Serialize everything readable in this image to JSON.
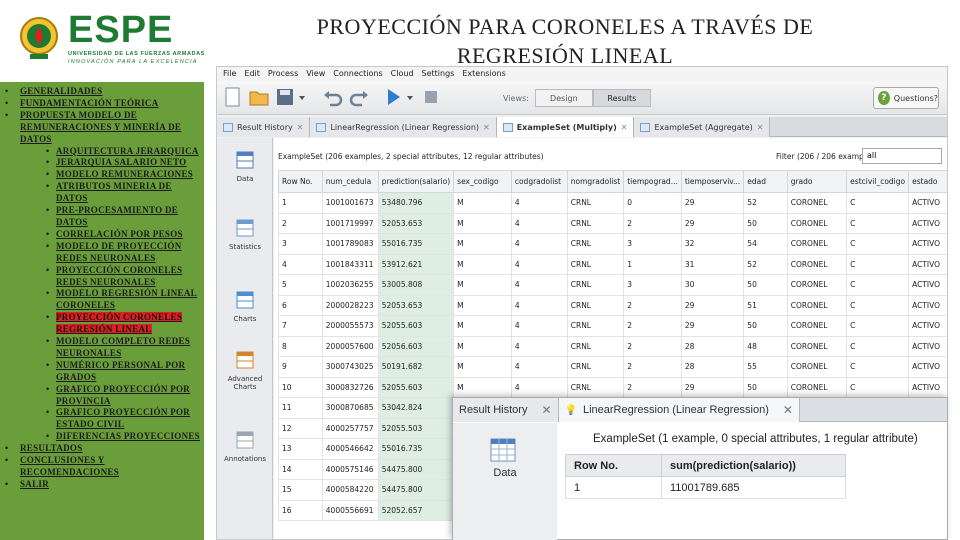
{
  "brand": {
    "name": "ESPE",
    "subtitle1": "UNIVERSIDAD DE LAS FUERZAS ARMADAS",
    "subtitle2": "INNOVACIÓN PARA LA EXCELENCIA",
    "color": "#1e7b34"
  },
  "slide": {
    "title": "PROYECCIÓN PARA CORONELES A TRAVÉS DE REGRESIÓN LINEAL"
  },
  "outline": {
    "panel_color": "#6a9e3a",
    "highlight_color": "#e02020",
    "items": [
      {
        "level": 1,
        "text": "GENERALIDADES"
      },
      {
        "level": 1,
        "text": "FUNDAMENTACIÓN TEÓRICA"
      },
      {
        "level": 1,
        "text": "PROPUESTA MODELO DE REMUNERACIONES Y MINERÍA DE DATOS"
      },
      {
        "level": 2,
        "text": "ARQUITECTURA JERARQUICA"
      },
      {
        "level": 2,
        "text": "JERARQUIA SALARIO NETO"
      },
      {
        "level": 2,
        "text": "MODELO REMUNERACIONES"
      },
      {
        "level": 2,
        "text": "ATRIBUTOS MINERIA DE DATOS"
      },
      {
        "level": 2,
        "text": "PRE-PROCESAMIENTO DE DATOS"
      },
      {
        "level": 2,
        "text": "CORRELACIÓN POR PESOS"
      },
      {
        "level": 2,
        "text": "MODELO DE PROYECCIÓN REDES NEURONALES"
      },
      {
        "level": 2,
        "text": "PROYECCIÓN CORONELES REDES NEURONALES"
      },
      {
        "level": 2,
        "text": "MODELO REGRESIÓN LINEAL CORONELES"
      },
      {
        "level": 2,
        "text": "PROYECCIÓN CORONELES REGRESIÓN LINEAL",
        "highlighted": true
      },
      {
        "level": 2,
        "text": "MODELO COMPLETO REDES NEURONALES"
      },
      {
        "level": 2,
        "text": "NUMÉRICO PERSONAL POR GRADOS"
      },
      {
        "level": 2,
        "text": "GRAFICO PROYECCIÓN POR PROVINCIA"
      },
      {
        "level": 2,
        "text": "GRAFICO PROYECCIÓN POR ESTADO CIVIL"
      },
      {
        "level": 2,
        "text": "DIFERENCIAS PROYECCIONES"
      },
      {
        "level": 1,
        "text": "RESULTADOS"
      },
      {
        "level": 1,
        "text": "CONCLUSIONES Y RECOMENDACIONES"
      },
      {
        "level": 1,
        "text": "SALIR"
      }
    ]
  },
  "app": {
    "menu": [
      "File",
      "Edit",
      "Process",
      "View",
      "Connections",
      "Cloud",
      "Settings",
      "Extensions"
    ],
    "views": {
      "label": "Views:",
      "design": "Design",
      "results": "Results"
    },
    "help_button": "Questions?",
    "tabs": [
      {
        "label": "Result History",
        "active": false
      },
      {
        "label": "LinearRegression (Linear Regression)",
        "active": false
      },
      {
        "label": "ExampleSet (Multiply)",
        "active": true
      },
      {
        "label": "ExampleSet (Aggregate)",
        "active": false
      }
    ],
    "sidebar": [
      {
        "icon": "data-table-icon",
        "label": "Data"
      },
      {
        "icon": "statistics-icon",
        "label": "Statistics"
      },
      {
        "icon": "charts-icon",
        "label": "Charts"
      },
      {
        "icon": "advanced-charts-icon",
        "label": "Advanced Charts"
      },
      {
        "icon": "annotations-icon",
        "label": "Annotations"
      }
    ],
    "exampleset_info": "ExampleSet (206 examples, 2 special attributes, 12 regular attributes)",
    "filter_label": "Filter (206 / 206 examples):",
    "filter_value": "all",
    "columns": [
      "Row No.",
      "num_cedula",
      "prediction(salario)",
      "sex_codigo",
      "codgradolist",
      "nomgradolist",
      "tiempograd...",
      "tiemposerviv...",
      "edad",
      "grado",
      "estcivil_codigo",
      "estado"
    ],
    "rows": [
      [
        "1",
        "1001001673",
        "53480.796",
        "M",
        "4",
        "CRNL",
        "0",
        "29",
        "52",
        "CORONEL",
        "C",
        "ACTIVO"
      ],
      [
        "2",
        "1001719997",
        "52053.653",
        "M",
        "4",
        "CRNL",
        "2",
        "29",
        "50",
        "CORONEL",
        "C",
        "ACTIVO"
      ],
      [
        "3",
        "1001789083",
        "55016.735",
        "M",
        "4",
        "CRNL",
        "3",
        "32",
        "54",
        "CORONEL",
        "C",
        "ACTIVO"
      ],
      [
        "4",
        "1001843311",
        "53912.621",
        "M",
        "4",
        "CRNL",
        "1",
        "31",
        "52",
        "CORONEL",
        "C",
        "ACTIVO"
      ],
      [
        "5",
        "1002036255",
        "53005.808",
        "M",
        "4",
        "CRNL",
        "3",
        "30",
        "50",
        "CORONEL",
        "C",
        "ACTIVO"
      ],
      [
        "6",
        "2000028223",
        "52053.653",
        "M",
        "4",
        "CRNL",
        "2",
        "29",
        "51",
        "CORONEL",
        "C",
        "ACTIVO"
      ],
      [
        "7",
        "2000055573",
        "52055.603",
        "M",
        "4",
        "CRNL",
        "2",
        "29",
        "50",
        "CORONEL",
        "C",
        "ACTIVO"
      ],
      [
        "8",
        "2000057600",
        "52056.603",
        "M",
        "4",
        "CRNL",
        "2",
        "28",
        "48",
        "CORONEL",
        "C",
        "ACTIVO"
      ],
      [
        "9",
        "3000743025",
        "50191.682",
        "M",
        "4",
        "CRNL",
        "2",
        "28",
        "55",
        "CORONEL",
        "C",
        "ACTIVO"
      ],
      [
        "10",
        "3000832726",
        "52055.603",
        "M",
        "4",
        "CRNL",
        "2",
        "29",
        "50",
        "CORONEL",
        "C",
        "ACTIVO"
      ],
      [
        "11",
        "3000870685",
        "53042.824",
        "M",
        "4",
        "CRNL",
        "",
        "",
        "",
        "",
        "",
        ""
      ],
      [
        "12",
        "4000257757",
        "52055.503",
        "M",
        "4",
        "CRNL",
        "",
        "",
        "",
        "",
        "",
        ""
      ],
      [
        "13",
        "4000546642",
        "55016.735",
        "M",
        "4",
        "CRNL",
        "",
        "",
        "",
        "",
        "",
        ""
      ],
      [
        "14",
        "4000575146",
        "54475.800",
        "M",
        "4",
        "CRNL",
        "",
        "",
        "",
        "",
        "",
        ""
      ],
      [
        "15",
        "4000584220",
        "54475.800",
        "M",
        "4",
        "CRNL",
        "",
        "",
        "",
        "",
        "",
        ""
      ],
      [
        "16",
        "4000556691",
        "52052.657",
        "M",
        "4",
        "CRNL",
        "",
        "",
        "",
        "",
        "",
        ""
      ]
    ],
    "popup": {
      "tabs": [
        {
          "label": "Result History",
          "active": false
        },
        {
          "label": "LinearRegression (Linear Regression)",
          "active": true
        }
      ],
      "side_label": "Data",
      "info": "ExampleSet (1 example, 0 special attributes, 1 regular attribute)",
      "columns": [
        "Row No.",
        "sum(prediction(salario))"
      ],
      "rows": [
        [
          "1",
          "11001789.685"
        ]
      ]
    }
  }
}
